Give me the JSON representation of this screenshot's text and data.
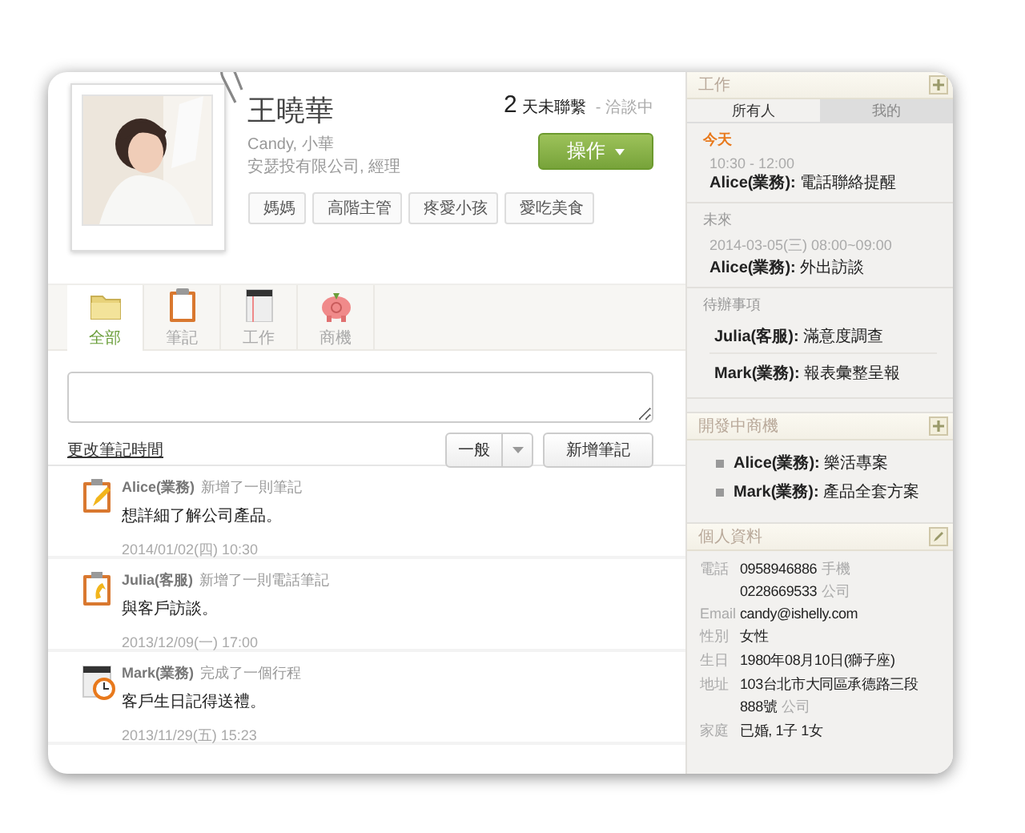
{
  "profile": {
    "name": "王曉華",
    "aliases": "Candy, 小華",
    "company": "安瑟投有限公司, 經理",
    "tags": [
      "媽媽",
      "高階主管",
      "疼愛小孩",
      "愛吃美食"
    ],
    "days_count": "2",
    "days_label": "天未聯繫",
    "status": "- 洽談中",
    "action_button": "操作"
  },
  "tabs": [
    {
      "label": "全部",
      "kind": "folder",
      "selected": true
    },
    {
      "label": "筆記",
      "kind": "clipboard",
      "selected": false
    },
    {
      "label": "工作",
      "kind": "calendar",
      "selected": false
    },
    {
      "label": "商機",
      "kind": "piggy",
      "selected": false
    }
  ],
  "note": {
    "change_time_link": "更改筆記時間",
    "type_select": "一般",
    "add_button": "新增筆記"
  },
  "activities": [
    {
      "kind": "note",
      "user": "Alice(業務)",
      "action": "新增了一則筆記",
      "text": "想詳細了解公司產品。",
      "time": "2014/01/02(四) 10:30"
    },
    {
      "kind": "phone",
      "user": "Julia(客服)",
      "action": "新增了一則電話筆記",
      "text": "與客戶訪談。",
      "time": "2013/12/09(一) 17:00"
    },
    {
      "kind": "calendar",
      "user": "Mark(業務)",
      "action": "完成了一個行程",
      "text": "客戶生日記得送禮。",
      "time": "2013/11/29(五) 15:23"
    }
  ],
  "work_panel": {
    "title": "工作",
    "tabs": [
      {
        "label": "所有人",
        "selected": true
      },
      {
        "label": "我的",
        "selected": false
      }
    ],
    "sections": [
      {
        "title": "今天",
        "highlight": true,
        "items": [
          {
            "time": "10:30 - 12:00",
            "text": "**Alice(業務):** 電話聯絡提醒"
          }
        ]
      },
      {
        "title": "未來",
        "highlight": false,
        "items": [
          {
            "time": "2014-03-05(三) 08:00~09:00",
            "text": "**Alice(業務):** 外出訪談"
          }
        ]
      },
      {
        "title": "待辦事項",
        "highlight": false,
        "items": [
          {
            "text": "**Julia(客服):** 滿意度調查"
          },
          {
            "text": "**Mark(業務):** 報表彙整呈報"
          }
        ]
      }
    ]
  },
  "deals_panel": {
    "title": "開發中商機",
    "items": [
      "**Alice(業務):** 樂活專案",
      "**Mark(業務):** 產品全套方案"
    ]
  },
  "personal_panel": {
    "title": "個人資料",
    "fields": [
      {
        "label": "電話",
        "values": [
          {
            "text": "0958946886",
            "note": "手機"
          },
          {
            "text": "0228669533",
            "note": "公司"
          }
        ]
      },
      {
        "label": "Email",
        "values": [
          {
            "text": "candy@ishelly.com"
          }
        ]
      },
      {
        "label": "性別",
        "values": [
          {
            "text": "女性"
          }
        ]
      },
      {
        "label": "生日",
        "values": [
          {
            "text": "1980年08月10日(獅子座)"
          }
        ]
      },
      {
        "label": "地址",
        "values": [
          {
            "text": "103台北市大同區承德路三段"
          },
          {
            "text": "888號",
            "note": "公司"
          }
        ]
      },
      {
        "label": "家庭",
        "values": [
          {
            "text": "已婚, 1子 1女"
          }
        ]
      }
    ]
  }
}
